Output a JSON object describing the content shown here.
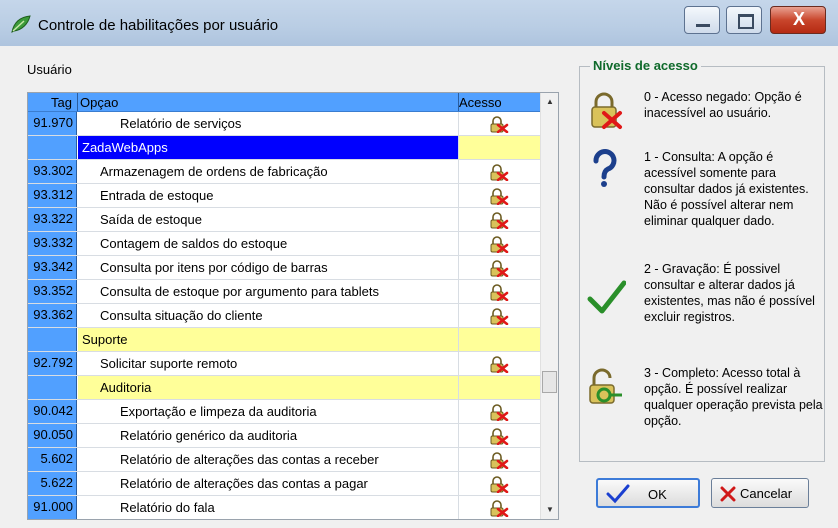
{
  "window": {
    "title": "Controle de habilitações por usuário"
  },
  "user_label": "Usuário",
  "grid": {
    "columns": {
      "tag": "Tag",
      "opcao": "Opçao",
      "acesso": "Acesso"
    },
    "rows": [
      {
        "tag": "91.970",
        "opcao": "Relatório de serviços",
        "indent": 2,
        "kind": "item"
      },
      {
        "tag": "",
        "opcao": "ZadaWebApps",
        "indent": 0,
        "kind": "selected"
      },
      {
        "tag": "93.302",
        "opcao": "Armazenagem de ordens de fabricação",
        "indent": 1,
        "kind": "item"
      },
      {
        "tag": "93.312",
        "opcao": "Entrada de estoque",
        "indent": 1,
        "kind": "item"
      },
      {
        "tag": "93.322",
        "opcao": "Saída de estoque",
        "indent": 1,
        "kind": "item"
      },
      {
        "tag": "93.332",
        "opcao": "Contagem de saldos do estoque",
        "indent": 1,
        "kind": "item"
      },
      {
        "tag": "93.342",
        "opcao": "Consulta por itens por código de barras",
        "indent": 1,
        "kind": "item"
      },
      {
        "tag": "93.352",
        "opcao": "Consulta de estoque por argumento para tablets",
        "indent": 1,
        "kind": "item"
      },
      {
        "tag": "93.362",
        "opcao": "Consulta situação do cliente",
        "indent": 1,
        "kind": "item"
      },
      {
        "tag": "",
        "opcao": "Suporte",
        "indent": 0,
        "kind": "group"
      },
      {
        "tag": "92.792",
        "opcao": "Solicitar suporte remoto",
        "indent": 1,
        "kind": "item"
      },
      {
        "tag": "",
        "opcao": "Auditoria",
        "indent": 1,
        "kind": "group"
      },
      {
        "tag": "90.042",
        "opcao": "Exportação e limpeza da auditoria",
        "indent": 2,
        "kind": "item"
      },
      {
        "tag": "90.050",
        "opcao": "Relatório genérico da auditoria",
        "indent": 2,
        "kind": "item"
      },
      {
        "tag": "5.602",
        "opcao": "Relatório de alterações das contas a receber",
        "indent": 2,
        "kind": "item"
      },
      {
        "tag": "5.622",
        "opcao": "Relatório de alterações das contas a pagar",
        "indent": 2,
        "kind": "item"
      },
      {
        "tag": "91.000",
        "opcao": "Relatório do fala",
        "indent": 2,
        "kind": "item"
      }
    ]
  },
  "levels": {
    "title": "Níveis de acesso",
    "items": [
      {
        "text": "0 - Acesso negado: Opção é inacessível ao usuário.",
        "icon": "lock-denied-icon"
      },
      {
        "text": "1 - Consulta: A opção é acessível somente para consultar dados já existentes. Não é possível alterar nem eliminar qualquer dado.",
        "icon": "question-icon"
      },
      {
        "text": "2 - Gravação: É possivel consultar e alterar dados já existentes, mas não é possível excluir registros.",
        "icon": "checkmark-icon"
      },
      {
        "text": "3 - Completo: Acesso total à opção. É possível realizar qualquer operação prevista pela opção.",
        "icon": "unlock-icon"
      }
    ]
  },
  "buttons": {
    "ok": "OK",
    "cancel": "Cancelar"
  },
  "colors": {
    "tag_column": "#51a0ff",
    "group_row": "#ffff99",
    "selected_row": "#0000ff",
    "levels_title": "#0f6a2b"
  }
}
